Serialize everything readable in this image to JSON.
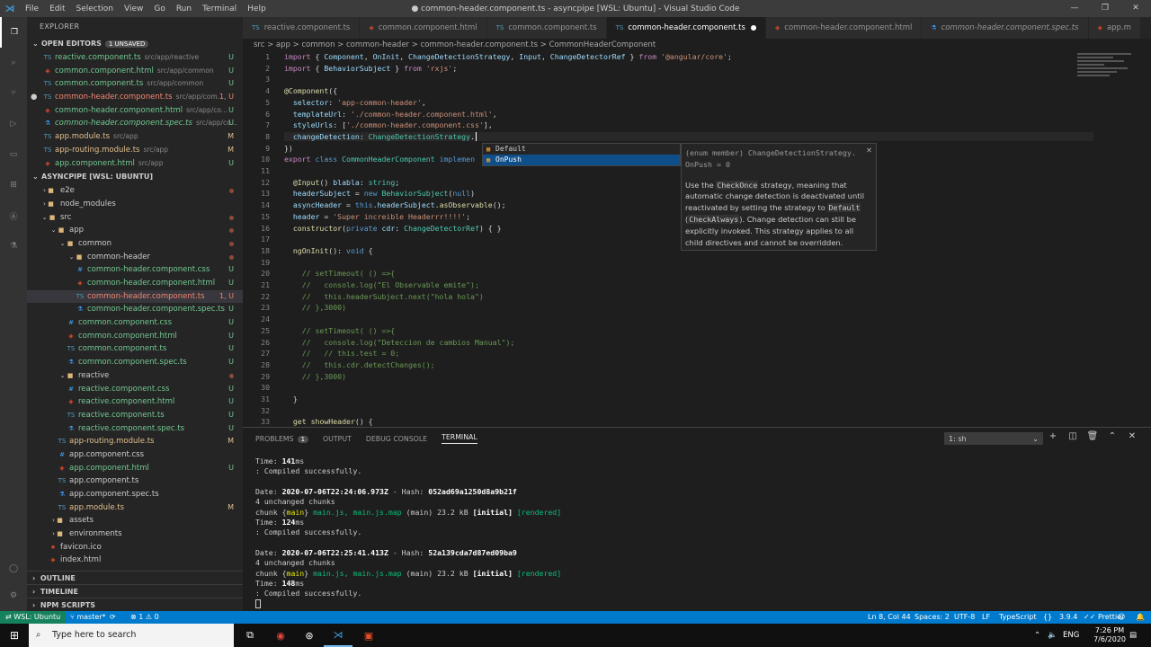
{
  "window": {
    "title": "● common-header.component.ts - asyncpipe [WSL: Ubuntu] - Visual Studio Code",
    "menu": [
      "File",
      "Edit",
      "Selection",
      "View",
      "Go",
      "Run",
      "Terminal",
      "Help"
    ]
  },
  "sidebar": {
    "title": "EXPLORER",
    "open_editors": "OPEN EDITORS",
    "unsaved": "1 UNSAVED",
    "open": [
      {
        "name": "reactive.component.ts",
        "dir": "src/app/reactive",
        "st": "U"
      },
      {
        "name": "common.component.html",
        "dir": "src/app/common",
        "st": "U"
      },
      {
        "name": "common.component.ts",
        "dir": "src/app/common",
        "st": "U"
      },
      {
        "name": "common-header.component.ts",
        "dir": "src/app/com...",
        "st": "1, U"
      },
      {
        "name": "common-header.component.html",
        "dir": "src/app/co...",
        "st": "U"
      },
      {
        "name": "common-header.component.spec.ts",
        "dir": "src/app/co...",
        "st": "U"
      },
      {
        "name": "app.module.ts",
        "dir": "src/app",
        "st": "M"
      },
      {
        "name": "app-routing.module.ts",
        "dir": "src/app",
        "st": "M"
      },
      {
        "name": "app.component.html",
        "dir": "src/app",
        "st": "U"
      }
    ],
    "workspace": "ASYNCPIPE [WSL: UBUNTU]",
    "tree": [
      {
        "name": "e2e",
        "st": ""
      },
      {
        "name": "node_modules",
        "st": ""
      },
      {
        "name": "src",
        "st": ""
      },
      {
        "name": "app",
        "st": ""
      },
      {
        "name": "common",
        "st": ""
      },
      {
        "name": "common-header",
        "st": ""
      },
      {
        "name": "common-header.component.css",
        "st": "U"
      },
      {
        "name": "common-header.component.html",
        "st": "U"
      },
      {
        "name": "common-header.component.ts",
        "st": "1, U"
      },
      {
        "name": "common-header.component.spec.ts",
        "st": "U"
      },
      {
        "name": "common.component.css",
        "st": "U"
      },
      {
        "name": "common.component.html",
        "st": "U"
      },
      {
        "name": "common.component.ts",
        "st": "U"
      },
      {
        "name": "common.component.spec.ts",
        "st": "U"
      },
      {
        "name": "reactive",
        "st": ""
      },
      {
        "name": "reactive.component.css",
        "st": "U"
      },
      {
        "name": "reactive.component.html",
        "st": "U"
      },
      {
        "name": "reactive.component.ts",
        "st": "U"
      },
      {
        "name": "reactive.component.spec.ts",
        "st": "U"
      },
      {
        "name": "app-routing.module.ts",
        "st": "M"
      },
      {
        "name": "app.component.css",
        "st": ""
      },
      {
        "name": "app.component.html",
        "st": "U"
      },
      {
        "name": "app.component.ts",
        "st": ""
      },
      {
        "name": "app.component.spec.ts",
        "st": ""
      },
      {
        "name": "app.module.ts",
        "st": "M"
      },
      {
        "name": "assets",
        "st": ""
      },
      {
        "name": "environments",
        "st": ""
      },
      {
        "name": "favicon.ico",
        "st": ""
      },
      {
        "name": "index.html",
        "st": ""
      }
    ],
    "outline": "OUTLINE",
    "timeline": "TIMELINE",
    "npm": "NPM SCRIPTS"
  },
  "tabs": [
    {
      "label": "reactive.component.ts"
    },
    {
      "label": "common.component.html"
    },
    {
      "label": "common.component.ts"
    },
    {
      "label": "common-header.component.ts"
    },
    {
      "label": "common-header.component.html"
    },
    {
      "label": "common-header.component.spec.ts"
    },
    {
      "label": "app.m"
    }
  ],
  "breadcrumb": "src > app > common > common-header > common-header.component.ts > CommonHeaderComponent",
  "suggest": {
    "items": [
      "Default",
      "OnPush"
    ]
  },
  "doc": {
    "sig": "(enum member) ChangeDetectionStrategy.\nOnPush = 0",
    "body": [
      "Use the",
      "CheckOnce",
      "strategy, meaning that automatic change detection is deactivated until reactivated by setting the strategy to",
      "Default",
      "(",
      "CheckAlways",
      "). Change detection can still be explicitly invoked. This strategy applies to all child directives and cannot be overridden."
    ]
  },
  "panel": {
    "tabs": [
      "PROBLEMS",
      "OUTPUT",
      "DEBUG CONSOLE",
      "TERMINAL"
    ],
    "problems_count": "1",
    "terminal_select": "1: sh"
  },
  "terminal": {
    "lines": [
      "Time: 141ms",
      ": Compiled successfully.",
      "",
      "Date: 2020-07-06T22:24:06.973Z - Hash: 052ad69a1250d8a9b21f",
      "4 unchanged chunks",
      "chunk {main} main.js, main.js.map (main) 23.2 kB [initial] [rendered]",
      "Time: 124ms",
      ": Compiled successfully.",
      "",
      "Date: 2020-07-06T22:25:41.413Z - Hash: 52a139cda7d87ed09ba9",
      "4 unchanged chunks",
      "chunk {main} main.js, main.js.map (main) 23.2 kB [initial] [rendered]",
      "Time: 148ms",
      ": Compiled successfully.",
      ""
    ]
  },
  "status": {
    "wsl": "WSL: Ubuntu",
    "branch": "master*",
    "errors": "⊗ 1 ⚠ 0",
    "pos": "Ln 8, Col 44",
    "spaces": "Spaces: 2",
    "enc": "UTF-8",
    "eol": "LF",
    "lang": "TypeScript",
    "ver": "3.9.4",
    "prettier": "Prettier"
  },
  "taskbar": {
    "search": "Type here to search",
    "lang": "ENG",
    "time": "7:26 PM",
    "date": "7/6/2020"
  }
}
